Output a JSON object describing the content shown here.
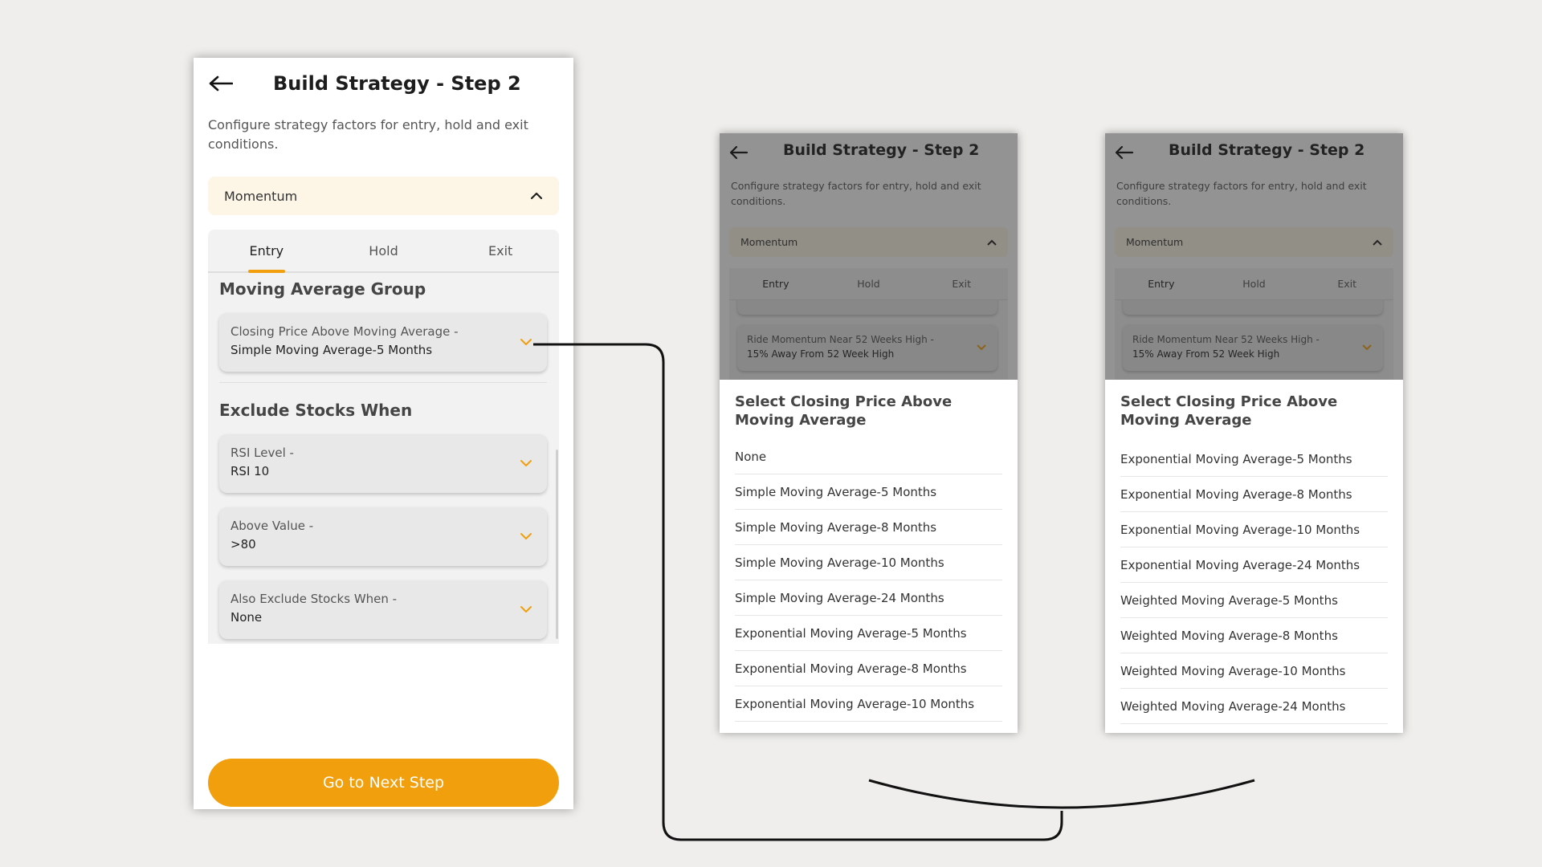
{
  "main_screen": {
    "title": "Build Strategy - Step 2",
    "description": "Configure strategy factors for entry, hold and exit conditions.",
    "category": "Momentum",
    "tabs": [
      {
        "label": "Entry",
        "active": true
      },
      {
        "label": "Hold",
        "active": false
      },
      {
        "label": "Exit",
        "active": false
      }
    ],
    "moving_average_group": {
      "heading": "Moving Average Group",
      "dropdown": {
        "label": "Closing Price Above Moving Average -",
        "value": "Simple Moving Average-5 Months"
      }
    },
    "exclude": {
      "heading": "Exclude Stocks When",
      "dropdowns": [
        {
          "label": "RSI Level -",
          "value": "RSI 10"
        },
        {
          "label": "Above Value -",
          "value": ">80"
        },
        {
          "label": "Also Exclude Stocks When -",
          "value": "None"
        }
      ]
    },
    "cta_label": "Go to Next Step"
  },
  "small_screens": {
    "title": "Build Strategy - Step 2",
    "description": "Configure strategy factors for entry, hold and exit conditions.",
    "category": "Momentum",
    "tabs": [
      "Entry",
      "Hold",
      "Exit"
    ],
    "partial_dropdown": {
      "label": "Ride Momentum Near 52 Weeks High -",
      "value": "15% Away From 52 Week High"
    }
  },
  "picker_1": {
    "title": "Select Closing Price Above Moving Average",
    "options": [
      "None",
      "Simple Moving Average-5 Months",
      "Simple Moving Average-8 Months",
      "Simple Moving Average-10 Months",
      "Simple Moving Average-24 Months",
      "Exponential Moving Average-5 Months",
      "Exponential Moving Average-8 Months",
      "Exponential Moving Average-10 Months"
    ]
  },
  "picker_2": {
    "title": "Select Closing Price Above Moving Average",
    "options": [
      "Exponential Moving Average-5 Months",
      "Exponential Moving Average-8 Months",
      "Exponential Moving Average-10 Months",
      "Exponential Moving Average-24 Months",
      "Weighted Moving Average-5 Months",
      "Weighted Moving Average-8 Months",
      "Weighted Moving Average-10 Months",
      "Weighted Moving Average-24 Months"
    ]
  },
  "colors": {
    "accent": "#f29f0e",
    "category_bg": "#fdf6e7",
    "panel_bg": "#f2f2f2",
    "canvas_bg": "#efeeec"
  },
  "icons": {
    "back": "arrow-left-icon",
    "collapse": "chevron-up-icon",
    "dropdown": "chevron-down-icon"
  }
}
